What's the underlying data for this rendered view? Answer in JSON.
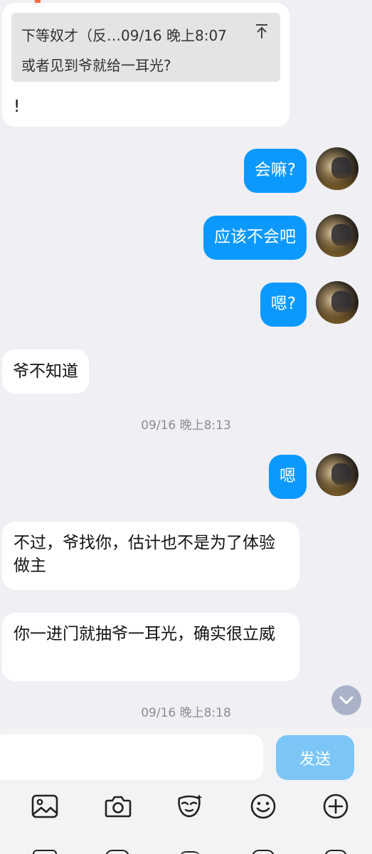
{
  "reply_message": {
    "quote_sender_time": "下等奴才（反…09/16 晚上8:07",
    "quote_text": "或者见到爷就给一耳光?",
    "text": "!"
  },
  "messages": [
    {
      "side": "out",
      "text": "会嘛?"
    },
    {
      "side": "out",
      "text": "应该不会吧"
    },
    {
      "side": "out",
      "text": "嗯?"
    },
    {
      "side": "in",
      "text": "爷不知道"
    },
    {
      "side": "time",
      "text": "09/16 晚上8:13"
    },
    {
      "side": "out",
      "text": "嗯"
    },
    {
      "side": "in",
      "text": "不过，爷找你，估计也不是为了体验做主"
    },
    {
      "side": "in",
      "text": "你一进门就抽爷一耳光，确实很立威"
    },
    {
      "side": "time",
      "text": "09/16 晚上8:18"
    }
  ],
  "input": {
    "value": "",
    "send_label": "发送"
  },
  "toolbar": {
    "icons": [
      "image-icon",
      "camera-icon",
      "mask-icon",
      "emoji-icon",
      "plus-icon"
    ]
  },
  "colors": {
    "background": "#efeff4",
    "sent_bubble": "#0b99ff",
    "received_bubble": "#ffffff",
    "send_button": "#7cc6f7",
    "accent_orange": "#ff6a3d"
  }
}
